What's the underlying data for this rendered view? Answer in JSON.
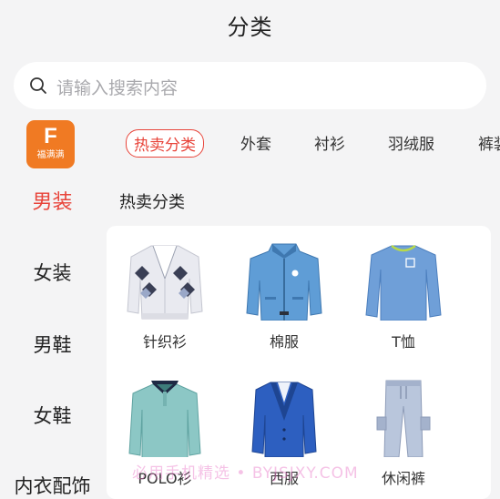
{
  "header": {
    "title": "分类"
  },
  "search": {
    "placeholder": "请输入搜索内容"
  },
  "logo": {
    "letter": "F",
    "text": "福满满"
  },
  "sidebar": {
    "items": [
      {
        "label": "男装",
        "active": true
      },
      {
        "label": "女装",
        "active": false
      },
      {
        "label": "男鞋",
        "active": false
      },
      {
        "label": "女鞋",
        "active": false
      },
      {
        "label": "内衣配饰",
        "active": false
      }
    ]
  },
  "tabs": [
    {
      "label": "热卖分类",
      "active": true
    },
    {
      "label": "外套",
      "active": false
    },
    {
      "label": "衬衫",
      "active": false
    },
    {
      "label": "羽绒服",
      "active": false
    },
    {
      "label": "裤装",
      "active": false
    }
  ],
  "section": {
    "title": "热卖分类"
  },
  "products": [
    {
      "label": "针织衫",
      "icon": "knit-cardigan-image"
    },
    {
      "label": "棉服",
      "icon": "padded-jacket-image"
    },
    {
      "label": "T恤",
      "icon": "long-sleeve-tee-image"
    },
    {
      "label": "POLO衫",
      "icon": "polo-shirt-image"
    },
    {
      "label": "西服",
      "icon": "suit-blazer-image"
    },
    {
      "label": "休闲裤",
      "icon": "casual-pants-image"
    }
  ],
  "watermark": {
    "text": "必用手机精选 • BYJSJXY.COM"
  },
  "colors": {
    "accent": "#e8443a",
    "logo_bg": "#f07a23",
    "background": "#f4f4f5",
    "panel": "#ffffff"
  }
}
